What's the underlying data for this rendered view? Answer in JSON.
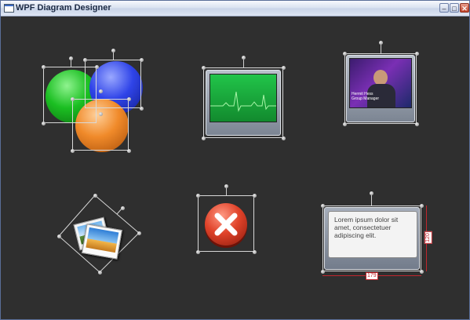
{
  "window": {
    "title": "WPF Diagram Designer"
  },
  "title_buttons": {
    "minimize": "–",
    "maximize": "□",
    "close": "✕"
  },
  "items": {
    "balls": {
      "colors": [
        "#1bbf22",
        "#2f44e8",
        "#f08a2a"
      ]
    },
    "monitor": {
      "screen_color": "#18a83a",
      "trace_color": "#a8f5a8"
    },
    "video": {
      "overlay_name": "Hermit Hess",
      "overlay_title": "Group Manager"
    },
    "photo_icon": {
      "icon": "photos-icon"
    },
    "close_icon": {
      "icon": "close-icon",
      "color": "#e0432a"
    },
    "note": {
      "text": "Lorem ipsum dolor sit amet, consectetuer adipiscing elit.",
      "width_label": "179",
      "height_label": "120"
    }
  }
}
